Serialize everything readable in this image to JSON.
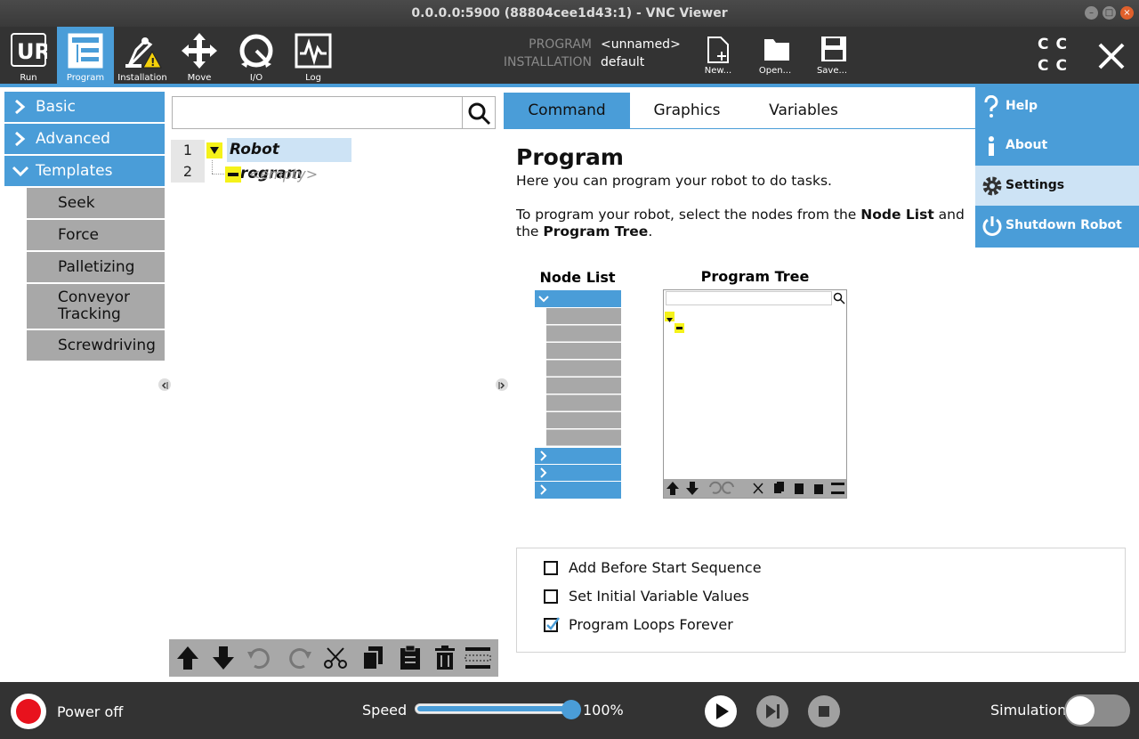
{
  "window": {
    "title": "0.0.0.0:5900 (88804cee1d43:1) - VNC Viewer"
  },
  "toolbar": {
    "items": [
      {
        "label": "Run",
        "icon": "ur-logo-icon"
      },
      {
        "label": "Program",
        "icon": "program-icon",
        "active": true
      },
      {
        "label": "Installation",
        "icon": "installation-warning-icon"
      },
      {
        "label": "Move",
        "icon": "move-arrows-icon"
      },
      {
        "label": "I/O",
        "icon": "io-icon"
      },
      {
        "label": "Log",
        "icon": "log-icon"
      }
    ],
    "program_label": "PROGRAM",
    "program_value": "<unnamed>",
    "installation_label": "INSTALLATION",
    "installation_value": "default",
    "new_label": "New...",
    "open_label": "Open...",
    "save_label": "Save...",
    "cc_top": "CC",
    "cc_bottom": "CC"
  },
  "sidebar": {
    "categories": [
      {
        "label": "Basic",
        "expanded": false
      },
      {
        "label": "Advanced",
        "expanded": false
      },
      {
        "label": "Templates",
        "expanded": true
      }
    ],
    "templates": [
      "Seek",
      "Force",
      "Palletizing",
      "Conveyor Tracking",
      "Screwdriving"
    ]
  },
  "tree": {
    "search_placeholder": "",
    "rows": [
      {
        "num": "1",
        "label": "Robot Program"
      },
      {
        "num": "2",
        "label": "<empty>"
      }
    ]
  },
  "tabs": [
    "Command",
    "Graphics",
    "Variables"
  ],
  "command": {
    "title": "Program",
    "intro": "Here you can program your robot to do tasks.",
    "instr_prefix": "To program your robot, select the nodes from the ",
    "instr_bold1": "Node List",
    "instr_mid": " and",
    "instr_line2_prefix": "the ",
    "instr_bold2": "Program Tree",
    "instr_end": ".",
    "node_list_title": "Node List",
    "program_tree_title": "Program Tree",
    "options": [
      {
        "label": "Add Before Start Sequence",
        "checked": false
      },
      {
        "label": "Set Initial Variable Values",
        "checked": false
      },
      {
        "label": "Program Loops Forever",
        "checked": true
      }
    ]
  },
  "menu": {
    "items": [
      {
        "label": "Help",
        "icon": "help-icon"
      },
      {
        "label": "About",
        "icon": "info-icon"
      },
      {
        "label": "Settings",
        "icon": "gear-icon",
        "selected": true
      },
      {
        "label": "Shutdown Robot",
        "icon": "power-icon"
      }
    ]
  },
  "footer": {
    "power_label": "Power off",
    "speed_label": "Speed",
    "speed_value": "100%",
    "speed_level": 1.0,
    "simulation_label": "Simulation",
    "simulation_on": false
  },
  "colors": {
    "accent": "#4a9dd8",
    "dark": "#333333",
    "node_yellow": "#f5f21a"
  }
}
